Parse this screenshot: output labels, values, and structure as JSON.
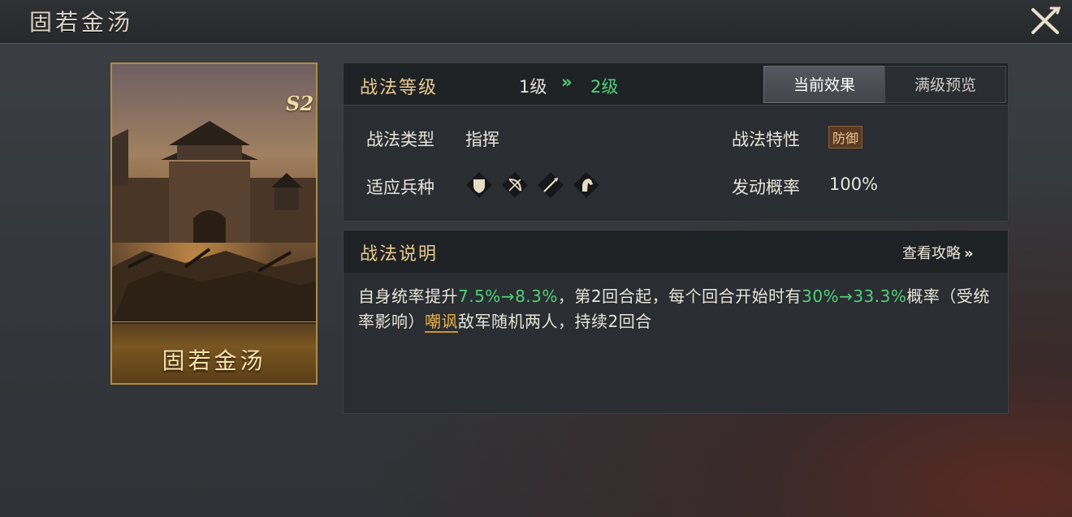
{
  "header": {
    "title": "固若金汤"
  },
  "card": {
    "name": "固若金汤",
    "season_badge": "S2"
  },
  "level": {
    "label": "战法等级",
    "current": "1级",
    "arrow": "»",
    "next": "2级"
  },
  "tabs": [
    {
      "label": "当前效果",
      "active": true
    },
    {
      "label": "满级预览",
      "active": false
    }
  ],
  "attributes": {
    "type_label": "战法类型",
    "type_value": "指挥",
    "trait_label": "战法特性",
    "trait_value": "防御",
    "troops_label": "适应兵种",
    "troops": [
      "shield-icon",
      "bow-icon",
      "spear-icon",
      "horse-icon"
    ],
    "rate_label": "发动概率",
    "rate_value": "100%"
  },
  "description": {
    "title": "战法说明",
    "guide_link": "查看攻略",
    "guide_arrow": "»",
    "parts": {
      "p1": "自身统率提升",
      "v1": "7.5%→8.3%",
      "p2": "，第2回合起，每个回合开始时有",
      "v2": "30%→33.3%",
      "p3": "概率（受统率影响）",
      "keyword": "嘲讽",
      "p4": "敌军随机两人，持续2回合"
    }
  },
  "colors": {
    "gold": "#e9c98c",
    "green": "#4dd17a",
    "keyword": "#e9b24a"
  }
}
